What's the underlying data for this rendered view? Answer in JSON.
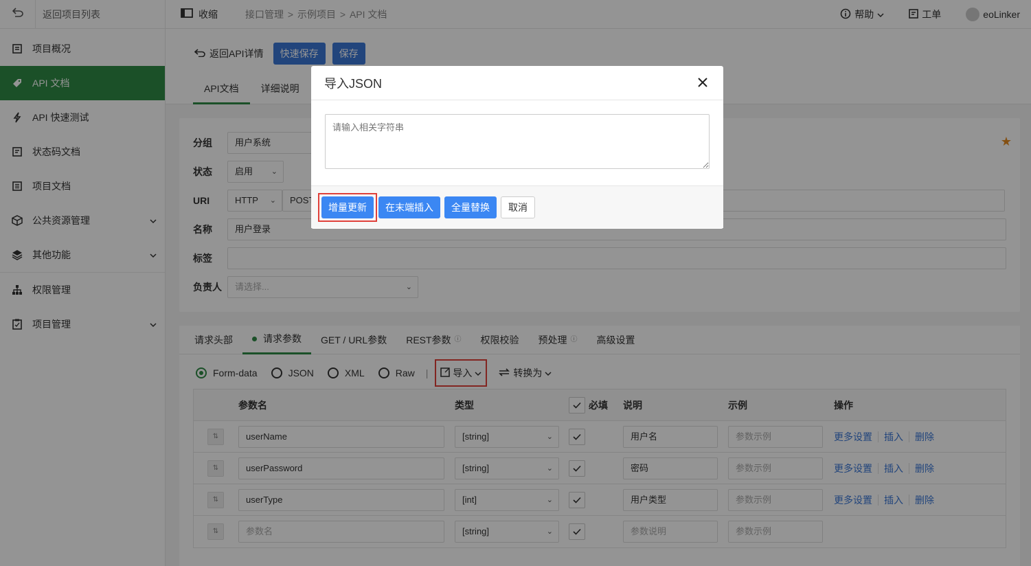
{
  "sidebar": {
    "back_label": "返回项目列表",
    "items": [
      {
        "label": "项目概况"
      },
      {
        "label": "API 文档"
      },
      {
        "label": "API 快速测试"
      },
      {
        "label": "状态码文档"
      },
      {
        "label": "项目文档"
      },
      {
        "label": "公共资源管理"
      },
      {
        "label": "其他功能"
      },
      {
        "label": "权限管理"
      },
      {
        "label": "项目管理"
      }
    ]
  },
  "topbar": {
    "collapse_label": "收缩",
    "breadcrumb": [
      "接口管理",
      ">",
      "示例项目",
      ">",
      "API 文档"
    ],
    "help_label": "帮助",
    "ticket_label": "工单",
    "user_name": "eoLinker"
  },
  "header": {
    "back_label": "返回API详情",
    "quick_save_label": "快速保存",
    "save_label": "保存",
    "tabs": [
      {
        "label": "API文档"
      },
      {
        "label": "详细说明"
      }
    ]
  },
  "form": {
    "group_label": "分组",
    "group_value": "用户系统",
    "status_label": "状态",
    "status_value": "启用",
    "uri_label": "URI",
    "protocol_value": "HTTP",
    "method_value": "POST",
    "name_label": "名称",
    "name_value": "用户登录",
    "tag_label": "标签",
    "tag_value": "",
    "owner_label": "负责人",
    "owner_placeholder": "请选择..."
  },
  "params": {
    "tabs": [
      {
        "label": "请求头部"
      },
      {
        "label": "请求参数"
      },
      {
        "label": "GET / URL参数"
      },
      {
        "label": "REST参数"
      },
      {
        "label": "权限校验"
      },
      {
        "label": "预处理"
      },
      {
        "label": "高级设置"
      }
    ],
    "modes": [
      "Form-data",
      "JSON",
      "XML",
      "Raw"
    ],
    "import_label": "导入",
    "convert_label": "转换为",
    "headers": {
      "name": "参数名",
      "type": "类型",
      "required": "必填",
      "desc": "说明",
      "example": "示例",
      "ops": "操作"
    },
    "rows": [
      {
        "name": "userName",
        "type": "[string]",
        "desc": "用户名",
        "example": ""
      },
      {
        "name": "userPassword",
        "type": "[string]",
        "desc": "密码",
        "example": ""
      },
      {
        "name": "userType",
        "type": "[int]",
        "desc": "用户类型",
        "example": ""
      }
    ],
    "empty_row": {
      "name_ph": "参数名",
      "type": "[string]",
      "desc_ph": "参数说明",
      "example_ph": "参数示例"
    },
    "example_placeholder": "参数示例",
    "ops": {
      "more": "更多设置",
      "insert": "插入",
      "delete": "删除"
    }
  },
  "modal": {
    "title": "导入JSON",
    "textarea_placeholder": "请输入相关字符串",
    "btn_incremental": "增量更新",
    "btn_append": "在末端插入",
    "btn_replace": "全量替换",
    "btn_cancel": "取消"
  },
  "colors": {
    "accent_green": "#2f8b46",
    "primary_blue": "#3b87f3",
    "highlight_red": "#e0403a"
  }
}
